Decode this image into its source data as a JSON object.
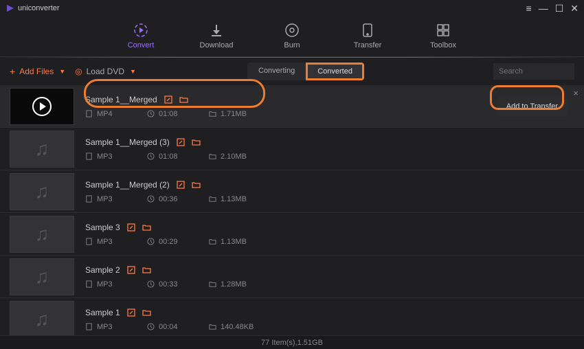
{
  "app": {
    "title": "uniconverter"
  },
  "nav": {
    "items": [
      {
        "label": "Convert",
        "icon": "convert"
      },
      {
        "label": "Download",
        "icon": "download"
      },
      {
        "label": "Burn",
        "icon": "burn"
      },
      {
        "label": "Transfer",
        "icon": "transfer"
      },
      {
        "label": "Toolbox",
        "icon": "toolbox"
      }
    ],
    "active_index": 0
  },
  "toolbar": {
    "add_files_label": "Add Files",
    "load_dvd_label": "Load DVD",
    "tabs": [
      "Converting",
      "Converted"
    ],
    "active_tab_index": 1,
    "search_placeholder": "Search"
  },
  "list": {
    "items": [
      {
        "title": "Sample 1__Merged",
        "format": "MP4",
        "duration": "01:08",
        "size": "1.71MB",
        "thumb": "video",
        "selected": true
      },
      {
        "title": "Sample 1__Merged (3)",
        "format": "MP3",
        "duration": "01:08",
        "size": "2.10MB",
        "thumb": "audio",
        "selected": false
      },
      {
        "title": "Sample 1__Merged (2)",
        "format": "MP3",
        "duration": "00:36",
        "size": "1.13MB",
        "thumb": "audio",
        "selected": false
      },
      {
        "title": "Sample 3",
        "format": "MP3",
        "duration": "00:29",
        "size": "1.13MB",
        "thumb": "audio",
        "selected": false
      },
      {
        "title": "Sample 2",
        "format": "MP3",
        "duration": "00:33",
        "size": "1.28MB",
        "thumb": "audio",
        "selected": false
      },
      {
        "title": "Sample 1",
        "format": "MP3",
        "duration": "00:04",
        "size": "140.48KB",
        "thumb": "audio",
        "selected": false
      }
    ],
    "add_to_transfer_label": "Add to Transfer"
  },
  "statusbar": {
    "items_count": "77 Item(s)",
    "total_size": "1.51GB"
  },
  "icons": {
    "plus": "+",
    "caret": "▾",
    "disc": "◎",
    "edit": "✎",
    "folder": "📁",
    "file": "file",
    "clock": "clock",
    "folder2": "folder"
  },
  "colors": {
    "accent": "#9a6fff",
    "orange": "#ff7a45",
    "annotation": "#ed7d31"
  }
}
